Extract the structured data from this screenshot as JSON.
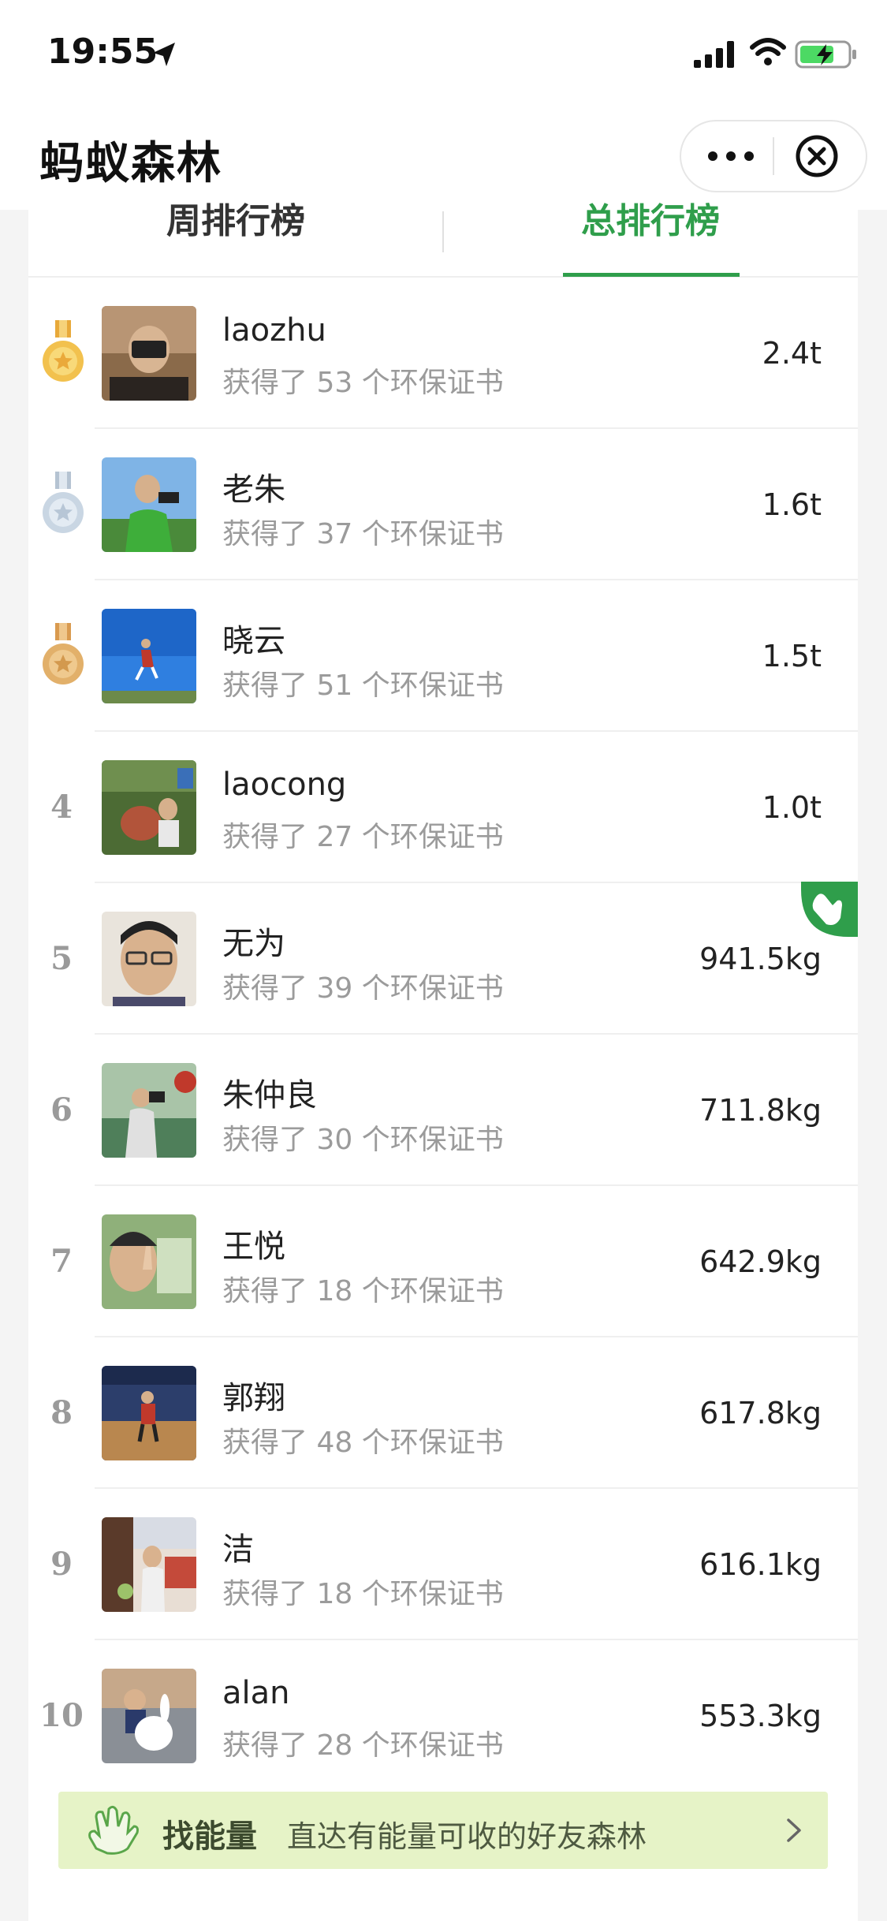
{
  "status_bar": {
    "time": "19:55"
  },
  "nav": {
    "title": "蚂蚁森林"
  },
  "tabs": [
    {
      "label": "周排行榜",
      "active": false
    },
    {
      "label": "总排行榜",
      "active": true
    }
  ],
  "ranking": [
    {
      "rank": "1",
      "medal": "gold",
      "name": "laozhu",
      "certificates": "获得了 53 个环保证书",
      "value": "2.4t"
    },
    {
      "rank": "2",
      "medal": "silver",
      "name": "老朱",
      "certificates": "获得了 37 个环保证书",
      "value": "1.6t"
    },
    {
      "rank": "3",
      "medal": "bronze",
      "name": "晓云",
      "certificates": "获得了 51 个环保证书",
      "value": "1.5t"
    },
    {
      "rank": "4",
      "name": "laocong",
      "certificates": "获得了 27 个环保证书",
      "value": "1.0t"
    },
    {
      "rank": "5",
      "name": "无为",
      "certificates": "获得了 39 个环保证书",
      "value": "941.5kg"
    },
    {
      "rank": "6",
      "name": "朱仲良",
      "certificates": "获得了 30 个环保证书",
      "value": "711.8kg"
    },
    {
      "rank": "7",
      "name": "王悦",
      "certificates": "获得了 18 个环保证书",
      "value": "642.9kg"
    },
    {
      "rank": "8",
      "name": "郭翔",
      "certificates": "获得了 48 个环保证书",
      "value": "617.8kg"
    },
    {
      "rank": "9",
      "name": "洁",
      "certificates": "获得了 18 个环保证书",
      "value": "616.1kg"
    },
    {
      "rank": "10",
      "name": "alan",
      "certificates": "获得了 28 个环保证书",
      "value": "553.3kg"
    }
  ],
  "banner": {
    "title": "找能量",
    "subtitle": "直达有能量可收的好友森林"
  },
  "colors": {
    "accent": "#2f9e4b",
    "banner_bg": "#e6f3c7",
    "gold": "#f2c14e",
    "silver": "#c9d6e3",
    "bronze": "#e2b06a"
  },
  "icons": [
    "location-arrow-icon",
    "signal-icon",
    "wifi-icon",
    "battery-charging-icon",
    "more-icon",
    "close-icon",
    "medal-icon",
    "hand-icon",
    "chevron-right-icon"
  ]
}
